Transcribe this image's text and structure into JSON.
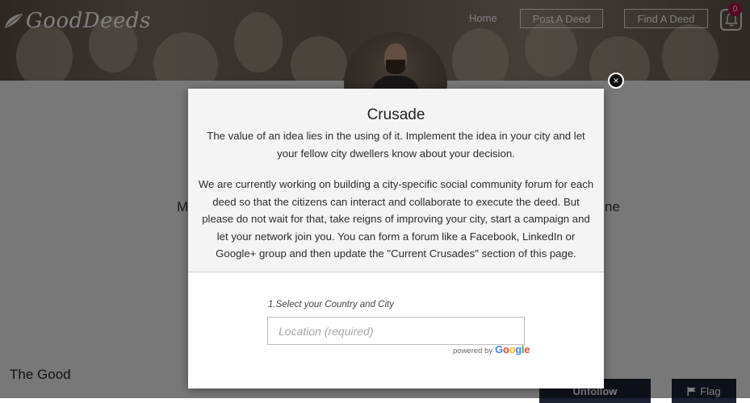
{
  "header": {
    "logo_text": "GoodDeeds",
    "nav": {
      "home": "Home",
      "post_a_deed": "Post A Deed",
      "find_a_deed": "Find A Deed"
    },
    "notification_count": "0",
    "icons": {
      "logo": "leaf-logo-icon",
      "bell": "bell-icon"
    }
  },
  "page": {
    "background_text_left": "M",
    "background_text_right": "ne",
    "section_title": "The Good",
    "unfollow_label": "Unfollow",
    "flag_label": "Flag"
  },
  "modal": {
    "title": "Crusade",
    "paragraph1": "The value of an idea lies in the using of it. Implement the idea in your city and let your fellow city dwellers know about your decision.",
    "paragraph2": "We are currently working on building a city-specific social community forum for each deed so that the citizens can interact and collaborate to execute the deed. But please do not wait for that, take reigns of improving your city, start a campaign and let your network join you. You can form a forum like a Facebook, LinkedIn or Google+ group and then update the \"Current Crusades\" section of this page.",
    "close_symbol": "×",
    "location": {
      "label": "1.Select your Country and City",
      "placeholder": "Location (required)",
      "value": "",
      "powered_by": "powered by",
      "google_text": "Google"
    }
  },
  "colors": {
    "badge": "#b0124a",
    "dark_button": "#1e2235",
    "overlay": "rgba(0,0,0,0.5)"
  }
}
